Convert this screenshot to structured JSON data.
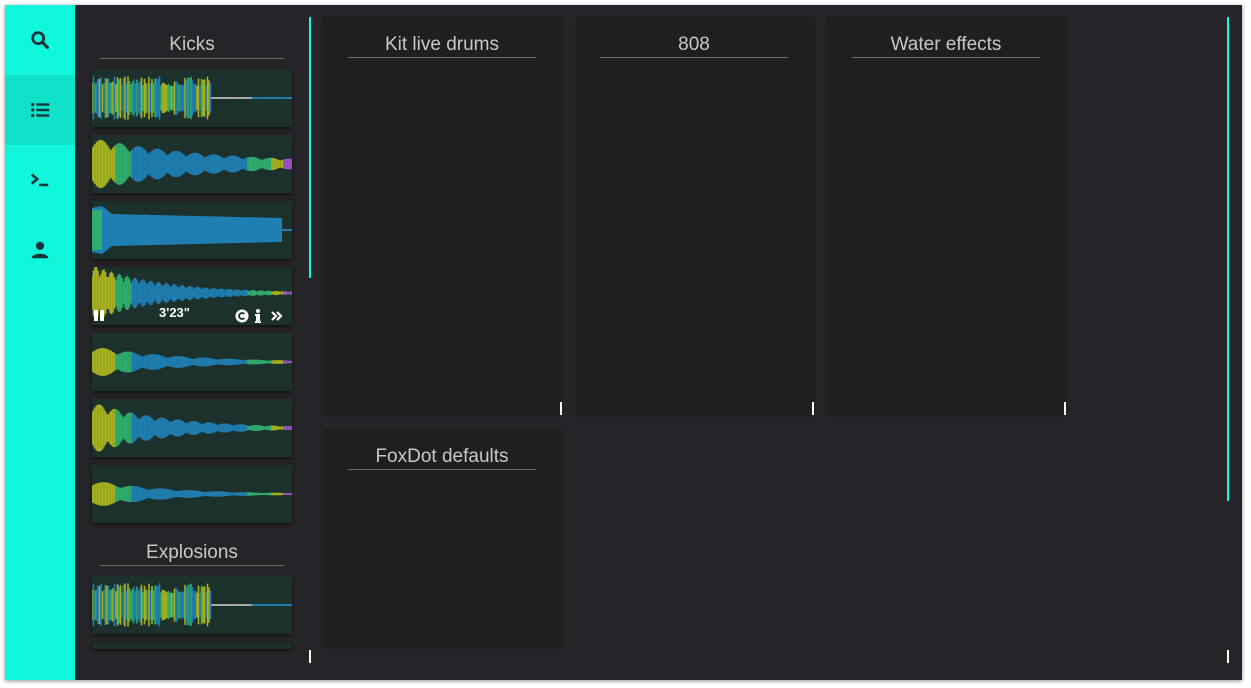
{
  "sidebar": {
    "items": [
      {
        "icon": "search-icon",
        "label": "Search"
      },
      {
        "icon": "list-icon",
        "label": "Lists",
        "active": true
      },
      {
        "icon": "terminal-icon",
        "label": "Console"
      },
      {
        "icon": "user-icon",
        "label": "Account"
      }
    ],
    "accent": "#10f7dc"
  },
  "sample_column": {
    "groups": [
      {
        "title": "Kicks",
        "samples": 7
      },
      {
        "title": "Explosions",
        "samples": 1
      }
    ],
    "player": {
      "time": "3'23\""
    }
  },
  "panels": [
    {
      "title": "Kit live drums"
    },
    {
      "title": "808"
    },
    {
      "title": "Water effects"
    },
    {
      "title": "FoxDot defaults"
    }
  ],
  "colors": {
    "background": "#252428",
    "panel": "#1f1f21",
    "waveform_blue": "#1f7fb3",
    "waveform_green": "#2fae6e",
    "waveform_yellow": "#a8b31e",
    "waveform_purple": "#9b52c9"
  }
}
